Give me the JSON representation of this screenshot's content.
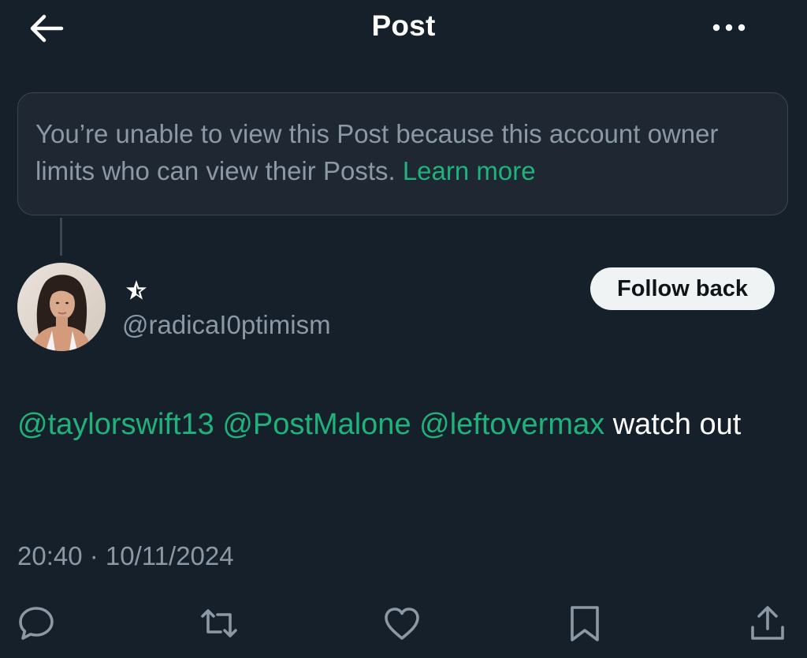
{
  "header": {
    "title": "Post",
    "back_icon": "arrow-left-icon",
    "more_icon": "more-horizontal-icon"
  },
  "notice": {
    "text": "You’re unable to view this Post because this account owner limits who can view their Posts.",
    "link_label": "Learn more"
  },
  "author": {
    "display_name_icon": "star-outline-icon",
    "handle": "@radicaI0ptimism",
    "follow_label": "Follow back"
  },
  "post": {
    "mentions": [
      "@taylorswift13",
      "@PostMalone",
      "@leftovermax"
    ],
    "text_after": "watch out",
    "timestamp": "20:40 · 10/11/2024"
  },
  "actions": [
    "reply-icon",
    "repost-icon",
    "like-icon",
    "bookmark-icon",
    "share-icon"
  ],
  "colors": {
    "background": "#16202a",
    "accent_green": "#1fb27a",
    "muted_text": "#8b98a5"
  }
}
